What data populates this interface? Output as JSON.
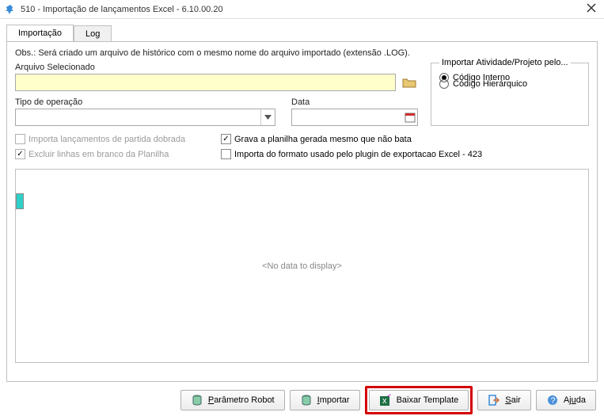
{
  "window": {
    "title": "510 - Importação de lançamentos Excel - 6.10.00.20"
  },
  "tabs": {
    "importacao": "Importação",
    "log": "Log"
  },
  "obs": "Obs.: Será criado um arquivo de histórico com o mesmo nome do arquivo importado (extensão .LOG).",
  "labels": {
    "arquivo": "Arquivo Selecionado",
    "tipo": "Tipo de operação",
    "data": "Data",
    "fieldset": "Importar Atividade/Projeto pelo...",
    "radio_interno": "Código Interno",
    "radio_hier": "Código Hierárquico"
  },
  "checkboxes": {
    "importa_partida": "Importa lançamentos de partida dobrada",
    "excluir_branco": "Excluir linhas em branco da Planilha",
    "grava_planilha": "Grava a planilha gerada mesmo que não bata",
    "importa_formato": "Importa do formato usado pelo plugin de exportacao Excel - 423"
  },
  "grid": {
    "nodata": "<No data to display>"
  },
  "buttons": {
    "parametro": "Parâmetro Robot",
    "importar": "Importar",
    "baixar": "Baixar Template",
    "sair": "Sair",
    "ajuda": "Ajuda"
  }
}
